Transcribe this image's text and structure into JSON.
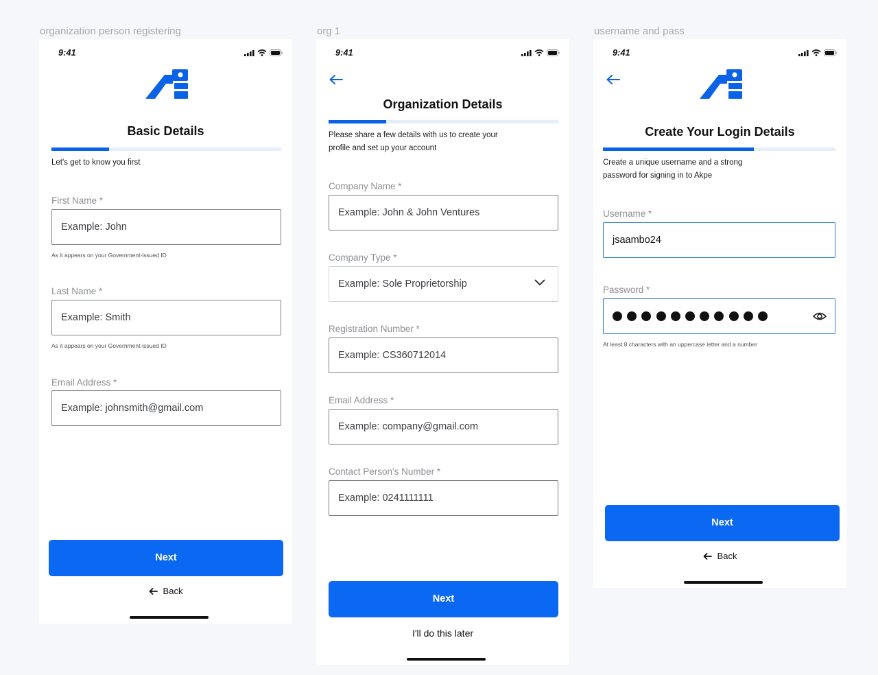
{
  "screens": [
    {
      "frame_label": "organization person registering",
      "time": "9:41",
      "title": "Basic Details",
      "progress": 0.25,
      "subtitle": "Let's get to know you first",
      "fields": [
        {
          "label": "First Name *",
          "placeholder": "Example: John",
          "helper": "As it appears on your Government-issued ID"
        },
        {
          "label": "Last Name *",
          "placeholder": "Example: Smith",
          "helper": "As it appears on your Government-issued ID"
        },
        {
          "label": "Email Address *",
          "placeholder": "Example: johnsmith@gmail.com"
        }
      ],
      "primary_button": "Next",
      "secondary_link": "Back"
    },
    {
      "frame_label": "org 1",
      "time": "9:41",
      "title": "Organization Details",
      "progress": 0.25,
      "subtitle_lines": [
        "Please share a few details with us to create your",
        "profile and set up your account"
      ],
      "fields": [
        {
          "label": "Company Name *",
          "placeholder": "Example: John & John Ventures"
        },
        {
          "label": "Company Type *",
          "placeholder": "Example: Sole Proprietorship",
          "dropdown": true
        },
        {
          "label": "Registration Number *",
          "placeholder": "Example: CS360712014"
        },
        {
          "label": "Email Address *",
          "placeholder": "Example: company@gmail.com"
        },
        {
          "label": "Contact Person's Number *",
          "placeholder": "Example: 0241111111"
        }
      ],
      "primary_button": "Next",
      "secondary_link": "I'll do this later"
    },
    {
      "frame_label": "username and pass",
      "time": "9:41",
      "title": "Create Your Login Details",
      "progress": 0.65,
      "subtitle_lines": [
        "Create a unique username and a strong",
        "password for signing in to Akpe"
      ],
      "fields": [
        {
          "label": "Username *",
          "value": "jsaambo24"
        },
        {
          "label": "Password *",
          "masked_length": 11,
          "helper": "At least 8 characters with an uppercase letter and a number"
        }
      ],
      "primary_button": "Next",
      "secondary_link": "Back"
    }
  ],
  "colors": {
    "accent": "#0a68f3",
    "progress_track": "#e4effb",
    "background": "#f6f7fa"
  },
  "icons": [
    "signal-icon",
    "wifi-icon",
    "battery-icon",
    "logo-icon",
    "back-arrow-icon",
    "chevron-down-icon",
    "eye-icon"
  ]
}
